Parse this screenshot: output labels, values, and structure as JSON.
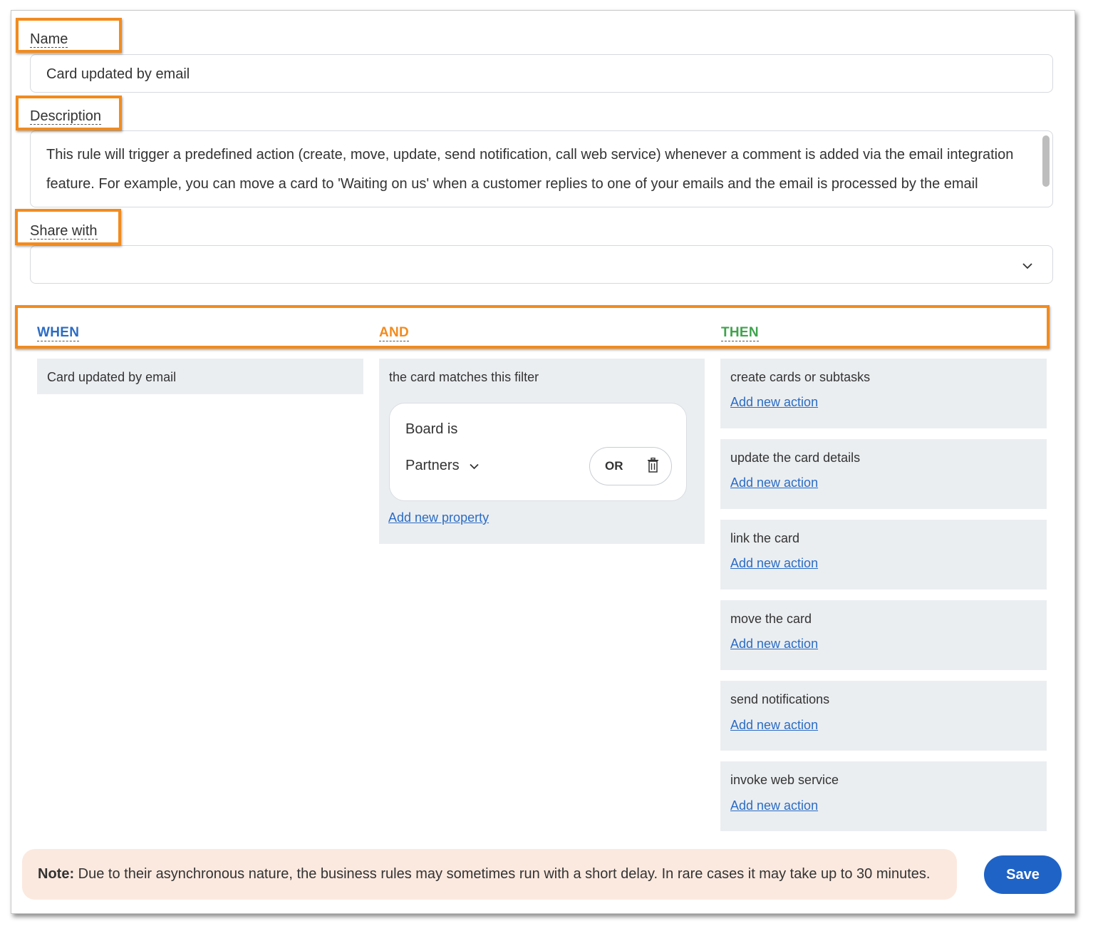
{
  "form": {
    "name_label": "Name",
    "name_value": "Card updated by email",
    "description_label": "Description",
    "description_value": "This rule will trigger a predefined action (create, move, update, send notification, call web service) whenever a comment is added via the email integration feature. For example, you can move a card to 'Waiting on us' when a customer replies to one of your emails and the email is processed by the email",
    "share_label": "Share with",
    "share_value": ""
  },
  "rule": {
    "when_label": "WHEN",
    "and_label": "AND",
    "then_label": "THEN",
    "when_trigger": "Card updated by email",
    "and_title": "the card matches this filter",
    "filter": {
      "property": "Board is",
      "value": "Partners",
      "or_label": "OR"
    },
    "add_property_link": "Add new property",
    "actions": [
      {
        "title": "create cards or subtasks",
        "link": "Add new action"
      },
      {
        "title": "update the card details",
        "link": "Add new action"
      },
      {
        "title": "link the card",
        "link": "Add new action"
      },
      {
        "title": "move the card",
        "link": "Add new action"
      },
      {
        "title": "send notifications",
        "link": "Add new action"
      },
      {
        "title": "invoke web service",
        "link": "Add new action"
      }
    ]
  },
  "footer": {
    "note_label": "Note:",
    "note_text": " Due to their asynchronous nature, the business rules may sometimes run with a short delay. In rare cases it may take up to 30 minutes.",
    "save_label": "Save"
  },
  "colors": {
    "when": "#2b6cc4",
    "and": "#f28b1e",
    "then": "#3fa34d",
    "highlight": "#f28b1e",
    "primary": "#1f63c6",
    "note_bg": "#fbe9df"
  },
  "icons": {
    "share_dropdown": "chevron-down-icon",
    "filter_value_dropdown": "chevron-down-icon",
    "delete": "trash-icon"
  }
}
